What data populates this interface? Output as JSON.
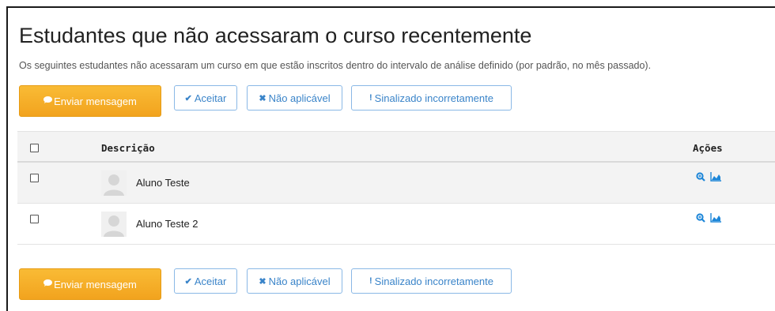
{
  "page": {
    "title": "Estudantes que não acessaram o curso recentemente",
    "description": "Os seguintes estudantes não acessaram um curso em que estão inscritos dentro do intervalo de análise definido (por padrão, no mês passado)."
  },
  "actions": {
    "send_message": "Enviar mensagem",
    "accept": "Aceitar",
    "not_applicable": "Não aplicável",
    "flagged_incorrectly": "Sinalizado incorretamente"
  },
  "table": {
    "headers": {
      "description": "Descrição",
      "actions": "Ações"
    },
    "rows": [
      {
        "name": "Aluno Teste"
      },
      {
        "name": "Aluno Teste 2"
      }
    ]
  },
  "colors": {
    "primary_button": "#f4a92a",
    "outline_button": "#3a84c9",
    "icon_blue": "#1d86d8"
  },
  "icons": [
    "chat-bubble-icon",
    "check-icon",
    "x-icon",
    "exclamation-icon",
    "zoom-icon",
    "chart-icon",
    "avatar-icon"
  ]
}
